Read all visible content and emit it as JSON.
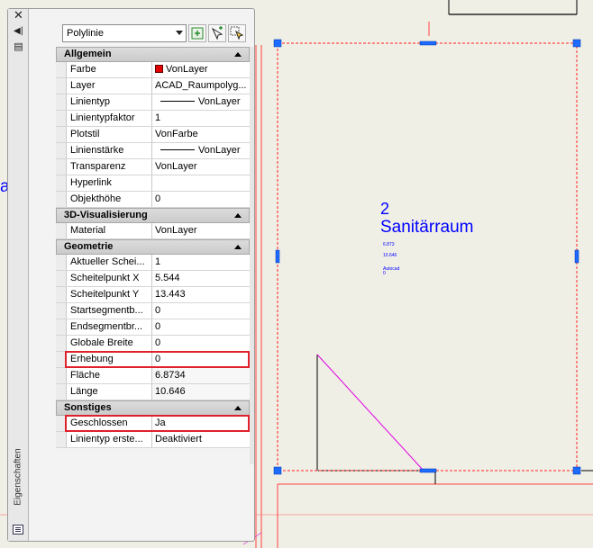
{
  "drawing": {
    "left_text": "au",
    "room": {
      "number": "2",
      "name": "Sanitärraum",
      "area": "6.873",
      "perimeter": "10.646",
      "autocad": "Autocad",
      "autocad_sub": "0"
    },
    "colors": {
      "linework": "#000000",
      "room_text": "#0000ff",
      "magenta": "#e000e0",
      "red_lines": "#ff0000",
      "grips": "#0064ff",
      "background": "#f0efe6"
    }
  },
  "palette": {
    "title": "Eigenschaften",
    "close_icon": "close-icon",
    "selector": {
      "value": "Polylinie"
    },
    "toolbar": [
      "quick-select-icon",
      "pick-add-icon",
      "select-objects-icon"
    ],
    "categories": [
      {
        "name": "Allgemein",
        "rows": [
          {
            "name": "Farbe",
            "value": "VonLayer",
            "swatch": "#e00000"
          },
          {
            "name": "Layer",
            "value": "ACAD_Raumpolyg..."
          },
          {
            "name": "Linientyp",
            "value": "VonLayer",
            "line": true
          },
          {
            "name": "Linientypfaktor",
            "value": "1"
          },
          {
            "name": "Plotstil",
            "value": "VonFarbe"
          },
          {
            "name": "Linienstärke",
            "value": "VonLayer",
            "line": true
          },
          {
            "name": "Transparenz",
            "value": "VonLayer"
          },
          {
            "name": "Hyperlink",
            "value": ""
          },
          {
            "name": "Objekthöhe",
            "value": "0"
          }
        ]
      },
      {
        "name": "3D-Visualisierung",
        "rows": [
          {
            "name": "Material",
            "value": "VonLayer"
          }
        ]
      },
      {
        "name": "Geometrie",
        "rows": [
          {
            "name": "Aktueller Schei...",
            "value": "1"
          },
          {
            "name": "Scheitelpunkt X",
            "value": "5.544"
          },
          {
            "name": "Scheitelpunkt Y",
            "value": "13.443"
          },
          {
            "name": "Startsegmentb...",
            "value": "0"
          },
          {
            "name": "Endsegmentbr...",
            "value": "0"
          },
          {
            "name": "Globale Breite",
            "value": "0"
          },
          {
            "name": "Erhebung",
            "value": "0",
            "highlight": true
          },
          {
            "name": "Fläche",
            "value": "6.8734",
            "readonly": true
          },
          {
            "name": "Länge",
            "value": "10.646",
            "readonly": true
          }
        ]
      },
      {
        "name": "Sonstiges",
        "rows": [
          {
            "name": "Geschlossen",
            "value": "Ja",
            "highlight": true
          },
          {
            "name": "Linientyp erste...",
            "value": "Deaktiviert"
          }
        ]
      }
    ]
  }
}
